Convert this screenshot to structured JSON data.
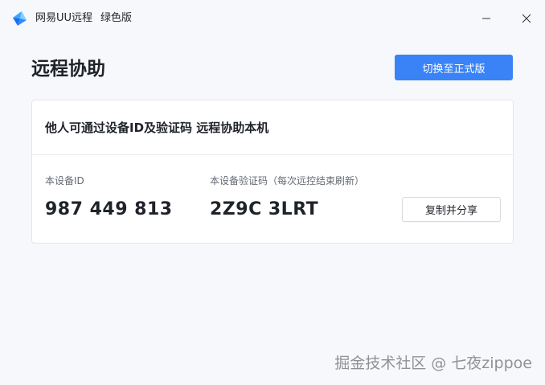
{
  "window": {
    "app_name": "网易UU远程",
    "edition": "绿色版"
  },
  "header": {
    "title": "远程协助",
    "switch_button_label": "切换至正式版"
  },
  "card": {
    "heading": "他人可通过设备ID及验证码 远程协助本机",
    "device_id_label": "本设备ID",
    "device_id_value": "987 449 813",
    "code_label": "本设备验证码（每次远控结束刷新）",
    "code_value": "2Z9C 3LRT",
    "copy_button_label": "复制并分享"
  },
  "watermark": {
    "text": "掘金技术社区 @ 七夜zippoe"
  },
  "colors": {
    "accent": "#3a83f7",
    "background": "#f6f8fb",
    "card": "#ffffff"
  },
  "icons": {
    "logo": "uu-logo-icon",
    "minimize": "minimize-icon",
    "close": "close-icon"
  }
}
